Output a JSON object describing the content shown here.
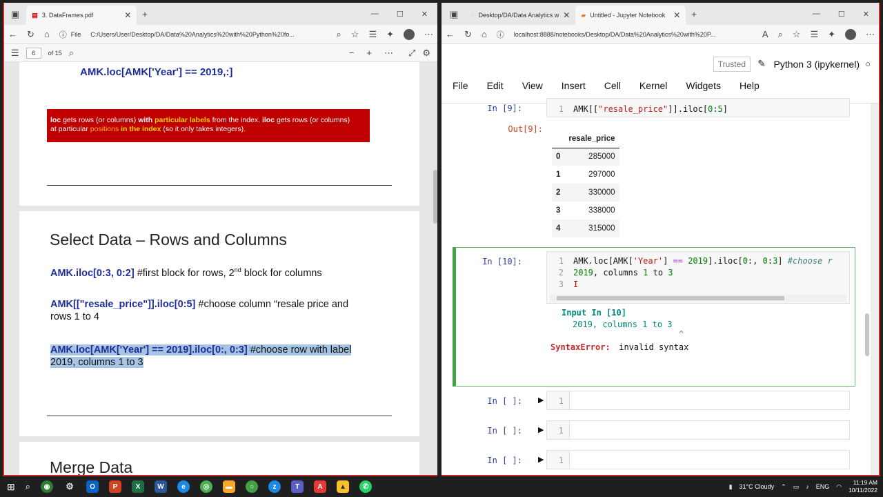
{
  "left_browser": {
    "tab_title": "3. DataFrames.pdf",
    "address_prefix": "File",
    "url": "C:/Users/User/Desktop/DA/Data%20Analytics%20with%20Python%20fo...",
    "page_number": "6",
    "page_total": "of 15"
  },
  "pdf": {
    "code_top": "AMK.loc[AMK['Year'] == 2019,:]",
    "redbox": {
      "p1": "loc",
      "p2": " gets rows (or columns) ",
      "p3": "with ",
      "p4": "particular labels",
      "p5": " from the index. ",
      "p6": "iloc",
      "p7": " gets rows (or columns)",
      "p8": "at particular ",
      "p9": "positions ",
      "p10": "in the index",
      "p11": " (so it only takes integers)."
    },
    "section_title": "Select Data – Rows and Columns",
    "line1_code": "AMK.iloc[0:3, 0:2]",
    "line1_comment": "  #first block for rows, 2",
    "line1_sup": "nd",
    "line1_tail": " block for columns",
    "line2_code": "AMK[[\"resale_price\"]].iloc[0:5]",
    "line2_comment": " #choose column “resale price and",
    "line2_tail": "rows 1 to 4",
    "line3_code": "AMK.loc[AMK['Year'] == 2019].iloc[0:, 0:3]",
    "line3_comment": " #choose row with label",
    "line3_tail": "2019, columns 1 to 3",
    "next_title": "Merge Data"
  },
  "right_browser": {
    "tab1_title": "Desktop/DA/Data Analytics with",
    "tab2_title": "Untitled - Jupyter Notebook",
    "url": "localhost:8888/notebooks/Desktop/DA/Data%20Analytics%20with%20P..."
  },
  "jupyter": {
    "trusted": "Trusted",
    "kernel": "Python 3 (ipykernel)",
    "menu": [
      "File",
      "Edit",
      "View",
      "Insert",
      "Cell",
      "Kernel",
      "Widgets",
      "Help"
    ],
    "cell9_prompt": "In [9]:",
    "cell9_code": "AMK[[\"resale_price\"]].iloc[0:5]",
    "out9_prompt": "Out[9]:",
    "table_header": "resale_price",
    "table_rows": [
      {
        "idx": "0",
        "val": "285000"
      },
      {
        "idx": "1",
        "val": "297000"
      },
      {
        "idx": "2",
        "val": "330000"
      },
      {
        "idx": "3",
        "val": "338000"
      },
      {
        "idx": "4",
        "val": "315000"
      }
    ],
    "cell10_prompt": "In [10]:",
    "cell10_line1": "AMK.loc[AMK['Year'] == 2019].iloc[0:, 0:3] #choose r",
    "cell10_line2": "2019, columns 1 to 3",
    "err_input": "Input In [10]",
    "err_line": "2019, columns 1 to 3",
    "err_caret": "^",
    "err_type": "SyntaxError:",
    "err_msg": " invalid syntax",
    "empty_prompt": "In [ ]:",
    "line_nums": [
      "1",
      "2",
      "3"
    ]
  },
  "taskbar": {
    "weather": "31°C  Cloudy",
    "lang": "ENG",
    "time": "11:19 AM",
    "date": "10/11/2022"
  }
}
